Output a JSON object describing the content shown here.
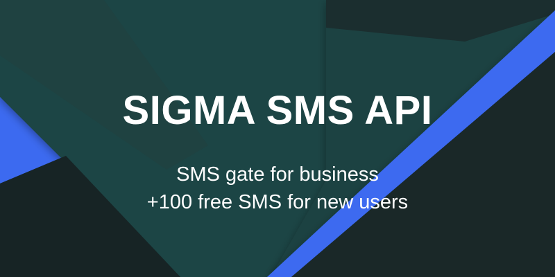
{
  "banner": {
    "title": "SIGMA SMS API",
    "subtitle_line1": "SMS gate for business",
    "subtitle_line2": "+100 free SMS for new users"
  },
  "colors": {
    "background_dark": "#1b2a2b",
    "panel_dark": "#182526",
    "panel_teal": "#1e4444",
    "panel_teal_light": "#234a49",
    "accent_blue": "#3c6af0",
    "text": "#ffffff"
  }
}
